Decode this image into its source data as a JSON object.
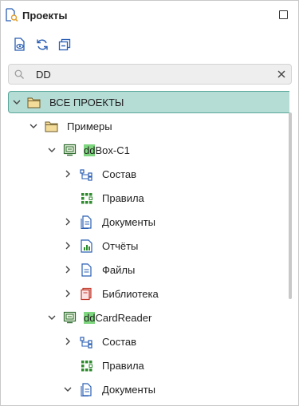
{
  "window": {
    "title": "Проекты"
  },
  "search": {
    "value": "DD",
    "placeholder": ""
  },
  "tree": {
    "root": "ВСЕ ПРОЕКТЫ",
    "examples": "Примеры",
    "project1": {
      "hl": "dd",
      "rest": "Box-C1"
    },
    "project2": {
      "hl": "dd",
      "rest": "CardReader"
    },
    "composition": "Состав",
    "rules": "Правила",
    "documents": "Документы",
    "reports": "Отчёты",
    "files": "Файлы",
    "library": "Библиотека"
  },
  "colors": {
    "selection_bg": "#b5ddd6",
    "selection_border": "#5aa79a",
    "match_highlight": "#7ed67e",
    "accent_blue": "#2b5fb4"
  }
}
